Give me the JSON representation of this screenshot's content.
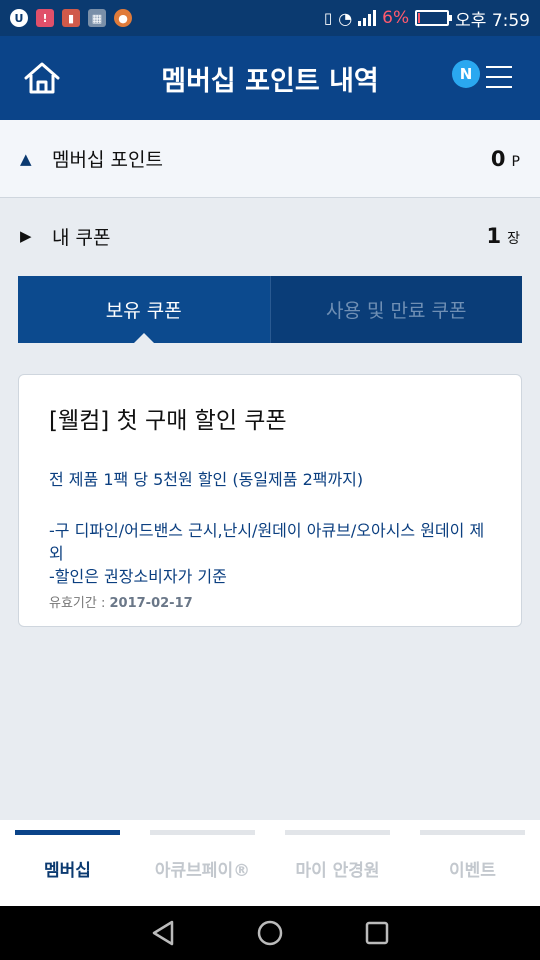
{
  "status_bar": {
    "battery_percent": "6%",
    "time": "오후 7:59",
    "notification_icons": [
      "app-logo-icon",
      "warning-icon",
      "store-icon",
      "image-icon",
      "game-icon"
    ]
  },
  "header": {
    "title": "멤버십 포인트 내역",
    "badge": "N"
  },
  "points": {
    "label": "멤버십 포인트",
    "value": "0",
    "unit": "P"
  },
  "coupons": {
    "label": "내 쿠폰",
    "count": "1",
    "unit": "장"
  },
  "tabs": [
    {
      "label": "보유 쿠폰",
      "active": true
    },
    {
      "label": "사용 및 만료 쿠폰",
      "active": false
    }
  ],
  "coupon_card": {
    "title": "[웰컴] 첫 구매 할인 쿠폰",
    "description": "전 제품 1팩 당 5천원 할인 (동일제품 2팩까지)",
    "note_1": "-구 디파인/어드밴스 근시,난시/원데이 아큐브/오아시스 원데이 제외",
    "note_2": "-할인은 권장소비자가 기준",
    "expiry_label": "유효기간 : ",
    "expiry_date": "2017-02-17"
  },
  "bottom_nav": [
    {
      "label": "멤버십",
      "active": true
    },
    {
      "label": "아큐브페이®",
      "active": false
    },
    {
      "label": "마이 안경원",
      "active": false
    },
    {
      "label": "이벤트",
      "active": false
    }
  ],
  "colors": {
    "primary": "#0b4489",
    "status_bar": "#0b3a70",
    "badge": "#2aa8f0",
    "battery_low": "#ff5a6e"
  }
}
